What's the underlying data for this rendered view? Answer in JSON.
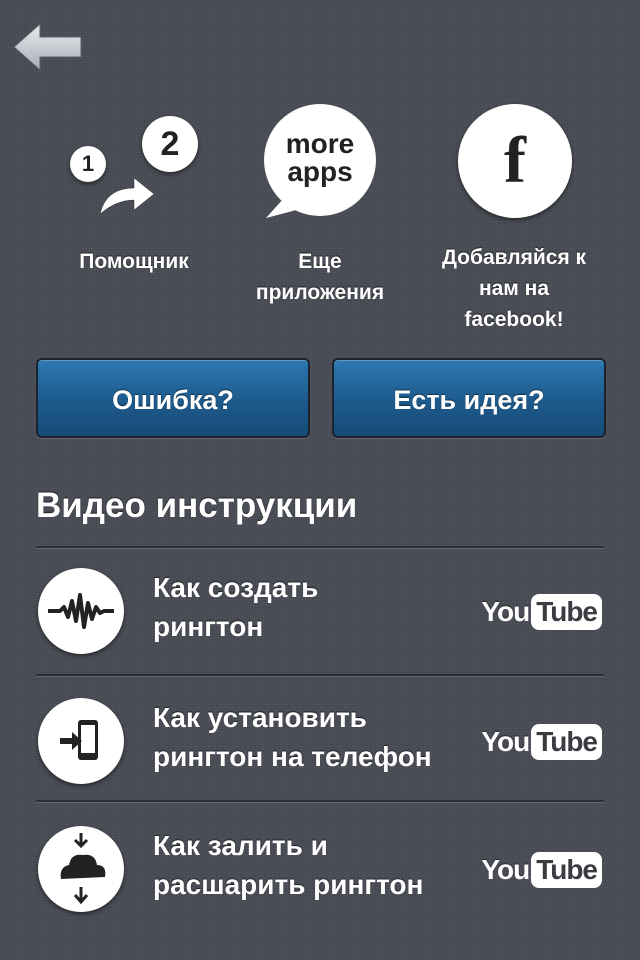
{
  "top_items": [
    {
      "label": "Помощник",
      "n1": "1",
      "n2": "2"
    },
    {
      "label": "Еще\nприложения",
      "icon_text": "more\napps"
    },
    {
      "label": "Добавляйся к\nнам на\nfacebook!",
      "icon_text": "f"
    }
  ],
  "buttons": {
    "bug": "Ошибка?",
    "idea": "Есть идея?"
  },
  "section_title": "Видео инструкции",
  "videos": [
    {
      "title": "Как создать\nрингтон",
      "icon": "waveform-icon"
    },
    {
      "title": "Как установить\nрингтон на телефон",
      "icon": "phone-transfer-icon"
    },
    {
      "title": "Как залить и\nрасшарить рингтон",
      "icon": "cloud-sync-icon"
    }
  ],
  "youtube": {
    "you": "You",
    "tube": "Tube"
  },
  "colors": {
    "button_blue": "#1d5a8c",
    "background": "#4a4d55"
  }
}
